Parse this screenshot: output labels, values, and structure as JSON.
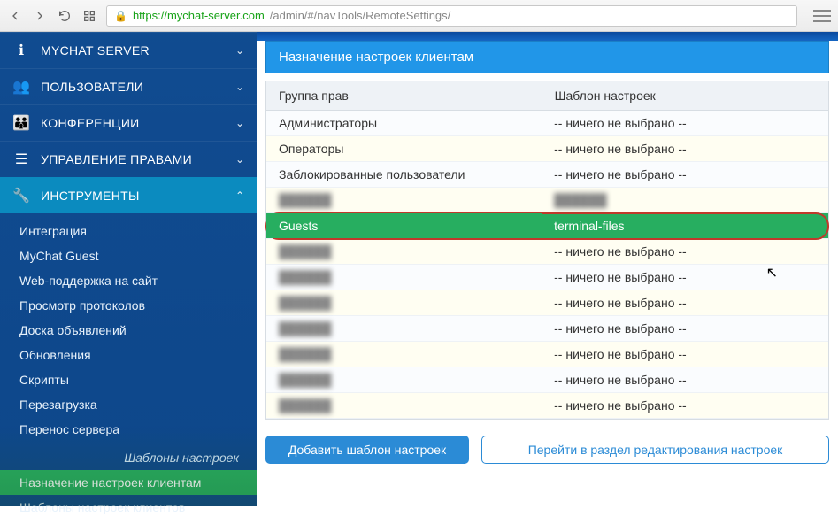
{
  "browser": {
    "url_host": "https://mychat-server.com",
    "url_path": "/admin/#/navTools/RemoteSettings/"
  },
  "sidebar": {
    "items": [
      {
        "icon": "info",
        "label": "MYCHAT SERVER"
      },
      {
        "icon": "users",
        "label": "ПОЛЬЗОВАТЕЛИ"
      },
      {
        "icon": "groups",
        "label": "КОНФЕРЕНЦИИ"
      },
      {
        "icon": "list",
        "label": "УПРАВЛЕНИЕ ПРАВАМИ"
      },
      {
        "icon": "wrench",
        "label": "ИНСТРУМЕНТЫ"
      }
    ],
    "tools_sub": [
      "Интеграция",
      "MyChat Guest",
      "Web-поддержка на сайт",
      "Просмотр протоколов",
      "Доска объявлений",
      "Обновления",
      "Скрипты",
      "Перезагрузка",
      "Перенос сервера"
    ],
    "tools_divider": "Шаблоны настроек",
    "tools_sub2": [
      "Назначение настроек клиентам",
      "Шаблоны настроек клиентов"
    ],
    "active_sub2_index": 0
  },
  "page": {
    "title": "Назначение настроек клиентам",
    "col_group": "Группа прав",
    "col_template": "Шаблон настроек",
    "nothing_selected": "-- ничего не выбрано --",
    "rows": [
      {
        "group": "Администраторы",
        "template": "-- ничего не выбрано --",
        "alt": false,
        "blur": false,
        "hl": false
      },
      {
        "group": "Операторы",
        "template": "-- ничего не выбрано --",
        "alt": true,
        "blur": false,
        "hl": false
      },
      {
        "group": "Заблокированные пользователи",
        "template": "-- ничего не выбрано --",
        "alt": false,
        "blur": false,
        "hl": false
      },
      {
        "group": "…",
        "template": "…",
        "alt": true,
        "blur": true,
        "hl": false
      },
      {
        "group": "Guests",
        "template": "terminal-files",
        "alt": false,
        "blur": false,
        "hl": true
      },
      {
        "group": "…",
        "template": "-- ничего не выбрано --",
        "alt": true,
        "blur": true,
        "hl": false,
        "blur_group_only": true
      },
      {
        "group": "…",
        "template": "-- ничего не выбрано --",
        "alt": false,
        "blur": true,
        "hl": false,
        "blur_group_only": true
      },
      {
        "group": "…",
        "template": "-- ничего не выбрано --",
        "alt": true,
        "blur": true,
        "hl": false,
        "blur_group_only": true
      },
      {
        "group": "…",
        "template": "-- ничего не выбрано --",
        "alt": false,
        "blur": true,
        "hl": false,
        "blur_group_only": true
      },
      {
        "group": "…",
        "template": "-- ничего не выбрано --",
        "alt": true,
        "blur": true,
        "hl": false,
        "blur_group_only": true
      },
      {
        "group": "…",
        "template": "-- ничего не выбрано --",
        "alt": false,
        "blur": true,
        "hl": false,
        "blur_group_only": true
      },
      {
        "group": "…",
        "template": "-- ничего не выбрано --",
        "alt": true,
        "blur": true,
        "hl": false,
        "blur_group_only": true
      }
    ],
    "btn_add": "Добавить шаблон настроек",
    "btn_goto": "Перейти в раздел редактирования настроек"
  }
}
